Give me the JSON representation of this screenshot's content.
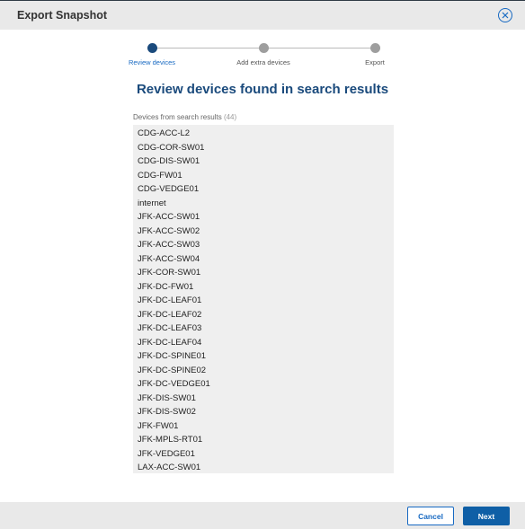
{
  "dialog": {
    "title": "Export Snapshot",
    "close_icon": "close-icon"
  },
  "stepper": {
    "steps": [
      {
        "label": "Review devices",
        "active": true
      },
      {
        "label": "Add extra devices",
        "active": false
      },
      {
        "label": "Export",
        "active": false
      }
    ]
  },
  "main": {
    "heading": "Review devices found in search results",
    "list_label": "Devices from search results",
    "list_count": "(44)",
    "devices": [
      "CDG-ACC-L2",
      "CDG-COR-SW01",
      "CDG-DIS-SW01",
      "CDG-FW01",
      "CDG-VEDGE01",
      "internet",
      "JFK-ACC-SW01",
      "JFK-ACC-SW02",
      "JFK-ACC-SW03",
      "JFK-ACC-SW04",
      "JFK-COR-SW01",
      "JFK-DC-FW01",
      "JFK-DC-LEAF01",
      "JFK-DC-LEAF02",
      "JFK-DC-LEAF03",
      "JFK-DC-LEAF04",
      "JFK-DC-SPINE01",
      "JFK-DC-SPINE02",
      "JFK-DC-VEDGE01",
      "JFK-DIS-SW01",
      "JFK-DIS-SW02",
      "JFK-FW01",
      "JFK-MPLS-RT01",
      "JFK-VEDGE01",
      "LAX-ACC-SW01"
    ]
  },
  "footer": {
    "cancel_label": "Cancel",
    "next_label": "Next"
  },
  "colors": {
    "accent": "#1769c2",
    "heading": "#1a4a7c",
    "primary_button": "#0f5fa6"
  }
}
